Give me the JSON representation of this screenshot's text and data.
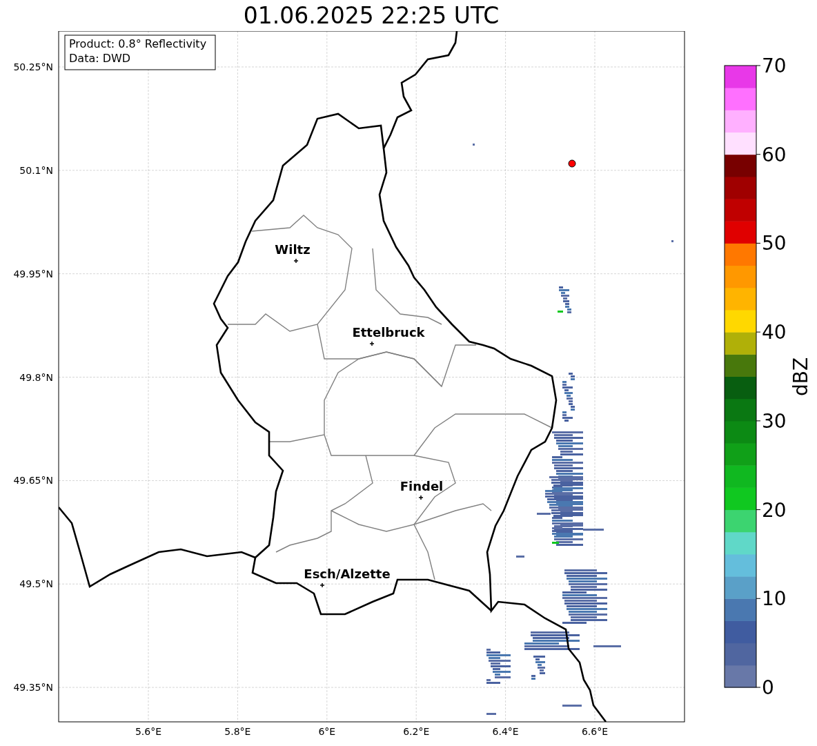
{
  "title": "01.06.2025 22:25 UTC",
  "legend": [
    "Product: 0.8° Reflectivity",
    "Data: DWD"
  ],
  "map": {
    "lon_labels": [
      "5.6°E",
      "5.8°E",
      "6°E",
      "6.2°E",
      "6.4°E",
      "6.6°E"
    ],
    "lat_labels": [
      "50.25°N",
      "50.1°N",
      "49.95°N",
      "49.8°N",
      "49.65°N",
      "49.5°N",
      "49.35°N"
    ],
    "cities": [
      "Wiltz",
      "Ettelbruck",
      "Findel",
      "Esch/Alzette"
    ]
  },
  "colorbar": {
    "label": "dBZ",
    "ticks": [
      "70",
      "60",
      "50",
      "40",
      "30",
      "20",
      "10",
      "0"
    ],
    "bins": [
      {
        "color": "#6878a8"
      },
      {
        "color": "#5066a0"
      },
      {
        "color": "#405ca0"
      },
      {
        "color": "#4a78b0"
      },
      {
        "color": "#5aa0c8"
      },
      {
        "color": "#64bedc"
      },
      {
        "color": "#60d8c8"
      },
      {
        "color": "#3cd470"
      },
      {
        "color": "#10c820"
      },
      {
        "color": "#10b820"
      },
      {
        "color": "#10a018"
      },
      {
        "color": "#0c8a14"
      },
      {
        "color": "#0a7812"
      },
      {
        "color": "#085e10"
      },
      {
        "color": "#48780c"
      },
      {
        "color": "#b0b008"
      },
      {
        "color": "#ffd800"
      },
      {
        "color": "#ffb400"
      },
      {
        "color": "#ff9800"
      },
      {
        "color": "#ff7800"
      },
      {
        "color": "#e00000"
      },
      {
        "color": "#c00000"
      },
      {
        "color": "#a00000"
      },
      {
        "color": "#780000"
      },
      {
        "color": "#ffe0ff"
      },
      {
        "color": "#ffb0ff"
      },
      {
        "color": "#ff70ff"
      },
      {
        "color": "#e838e8"
      }
    ]
  }
}
